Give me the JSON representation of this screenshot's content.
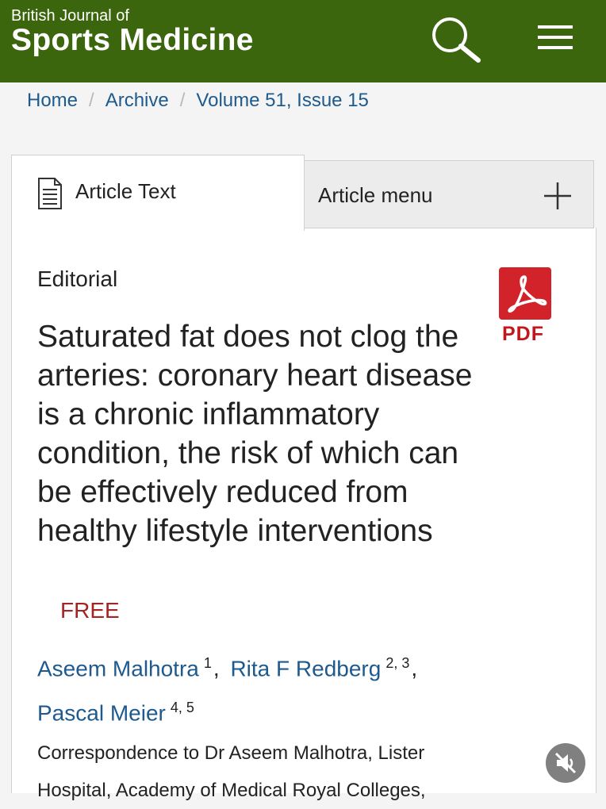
{
  "header": {
    "journal_prefix": "British Journal of",
    "journal_name": "Sports Medicine",
    "background_color": "#3b660e"
  },
  "breadcrumb": [
    "Home",
    "Archive",
    "Volume 51, Issue 15"
  ],
  "tabs": {
    "article_text": "Article Text",
    "article_menu": "Article menu"
  },
  "article": {
    "section": "Editorial",
    "title": "Saturated fat does not clog the arteries: coronary heart disease is a chronic inflammatory condition, the risk of which can be effectively reduced from healthy lifestyle interventions",
    "access_badge": "FREE",
    "pdf_label": "PDF",
    "authors": [
      {
        "name": "Aseem Malhotra",
        "affiliations": "1"
      },
      {
        "name": "Rita F Redberg",
        "affiliations": "2, 3"
      },
      {
        "name": "Pascal Meier",
        "affiliations": "4, 5"
      }
    ],
    "correspondence": "Correspondence to Dr Aseem Malhotra, Lister Hospital, Academy of Medical Royal Colleges,"
  },
  "icons": {
    "search": "search-icon",
    "menu": "hamburger-menu-icon",
    "document": "document-icon",
    "expand": "plus-icon",
    "pdf": "pdf-icon",
    "mute": "muted-speaker-icon"
  }
}
